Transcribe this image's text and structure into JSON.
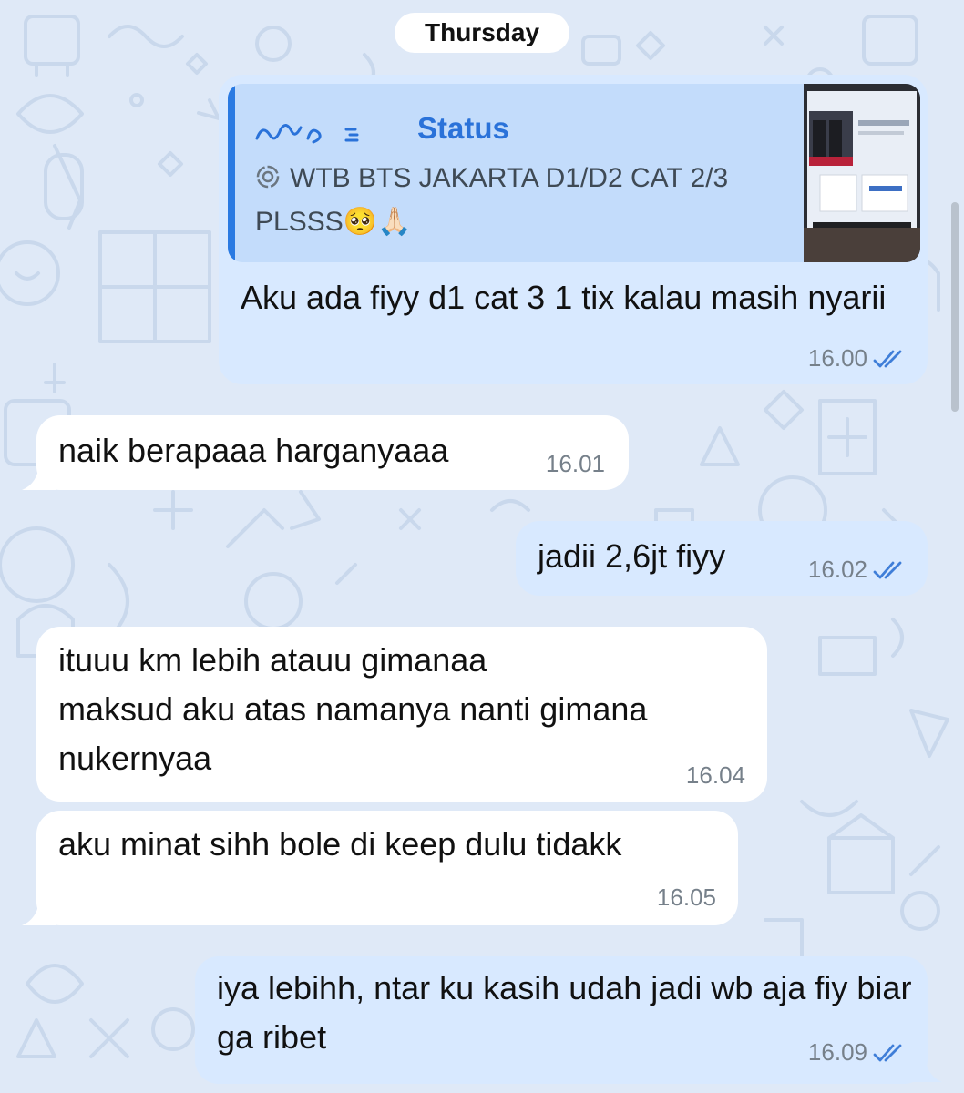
{
  "chat": {
    "day_label": "Thursday",
    "messages": [
      {
        "direction": "out",
        "quote": {
          "author": "Status",
          "text": "WTB BTS JAKARTA D1/D2 CAT 2/3 PLSSS",
          "emoji": "🥺🙏🏻",
          "status_icon": "status-ring-icon",
          "thumbnail": "status-thumbnail-image"
        },
        "text": "Aku ada fiyy d1 cat 3 1 tix kalau masih nyarii",
        "time": "16.00",
        "ticks": "double-check-icon"
      },
      {
        "direction": "in",
        "text": "naik berapaaa harganyaaa",
        "time": "16.01"
      },
      {
        "direction": "out",
        "text": "jadii 2,6jt fiyy",
        "time": "16.02",
        "ticks": "double-check-icon"
      },
      {
        "direction": "in",
        "text": "ituuu km lebih atauu gimanaa\nmaksud aku atas namanya nanti gimana nukernyaa",
        "time": "16.04"
      },
      {
        "direction": "in",
        "text": "aku minat sihh bole di keep dulu tidakk",
        "time": "16.05"
      },
      {
        "direction": "out",
        "text": "iya lebihh, ntar ku kasih udah jadi wb aja fiy biar ga ribet",
        "time": "16.09",
        "ticks": "double-check-icon"
      }
    ]
  },
  "colors": {
    "outgoing_bubble": "#d8e9ff",
    "incoming_bubble": "#ffffff",
    "chat_background": "#dfe9f7",
    "accent": "#2a72d9",
    "read_ticks": "#3f7ed8"
  }
}
